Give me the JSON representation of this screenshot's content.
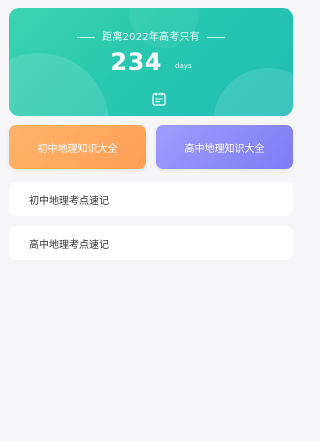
{
  "countdown": {
    "title": "距离2022年高考只有",
    "days": "234",
    "unit": "days"
  },
  "cards": {
    "junior": "初中地理知识大全",
    "senior": "高中地理知识大全"
  },
  "list": {
    "items": [
      "初中地理考点速记",
      "高中地理考点速记"
    ]
  },
  "colors": {
    "banner": "#2cc9b2",
    "junior_card": "#ffa860",
    "senior_card": "#8b88f8",
    "background": "#f6f6f8"
  }
}
